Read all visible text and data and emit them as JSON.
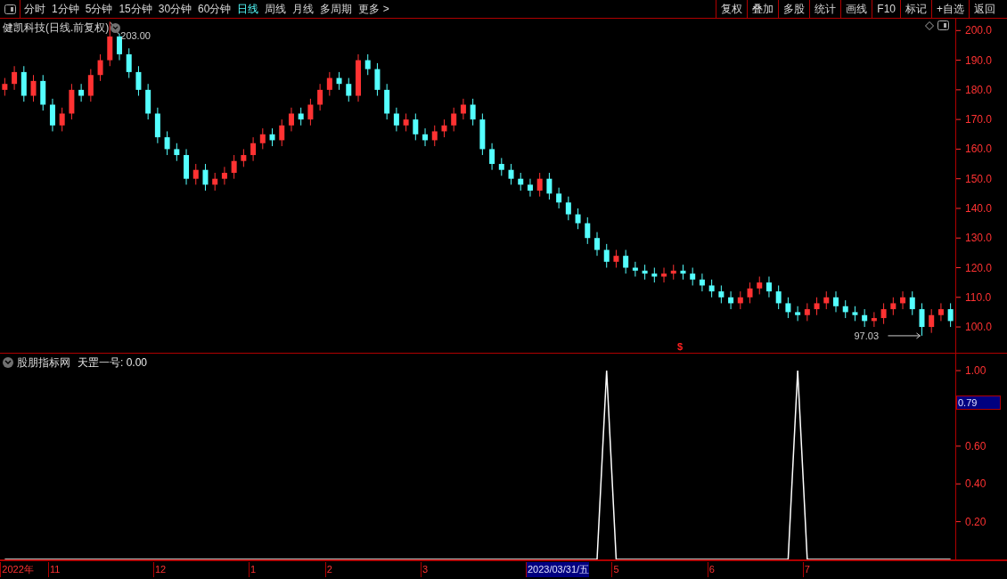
{
  "toolbar": {
    "periods": [
      {
        "label": "分时",
        "selected": false
      },
      {
        "label": "1分钟",
        "selected": false
      },
      {
        "label": "5分钟",
        "selected": false
      },
      {
        "label": "15分钟",
        "selected": false
      },
      {
        "label": "30分钟",
        "selected": false
      },
      {
        "label": "60分钟",
        "selected": false
      },
      {
        "label": "日线",
        "selected": true
      },
      {
        "label": "周线",
        "selected": false
      },
      {
        "label": "月线",
        "selected": false
      },
      {
        "label": "多周期",
        "selected": false
      }
    ],
    "more": "更多 >",
    "buttons": [
      "复权",
      "叠加",
      "多股",
      "统计",
      "画线",
      "F10",
      "标记",
      "+自选",
      "返回"
    ]
  },
  "price_panel": {
    "title": "健凯科技(日线.前复权)",
    "marker": "$",
    "chart_data": {
      "type": "candlestick",
      "ylim": [
        91,
        204
      ],
      "yticks": [
        {
          "value": 100,
          "label": "100.0"
        },
        {
          "value": 110,
          "label": "110.0"
        },
        {
          "value": 120,
          "label": "120.0"
        },
        {
          "value": 130,
          "label": "130.0"
        },
        {
          "value": 140,
          "label": "140.0"
        },
        {
          "value": 150,
          "label": "150.0"
        },
        {
          "value": 160,
          "label": "160.0"
        },
        {
          "value": 170,
          "label": "170.0"
        },
        {
          "value": 180,
          "label": "180.0"
        },
        {
          "value": 190,
          "label": "190.0"
        },
        {
          "value": 200,
          "label": "200.0"
        }
      ],
      "ohlc": [
        [
          180,
          184,
          178,
          182
        ],
        [
          182,
          188,
          180,
          186
        ],
        [
          186,
          188,
          176,
          178
        ],
        [
          178,
          185,
          176,
          183
        ],
        [
          183,
          185,
          173,
          175
        ],
        [
          175,
          177,
          166,
          168
        ],
        [
          168,
          174,
          166,
          172
        ],
        [
          172,
          182,
          170,
          180
        ],
        [
          180,
          182,
          176,
          178
        ],
        [
          178,
          187,
          176,
          185
        ],
        [
          185,
          192,
          183,
          190
        ],
        [
          190,
          203,
          188,
          198
        ],
        [
          198,
          199,
          190,
          192
        ],
        [
          192,
          194,
          184,
          186
        ],
        [
          186,
          188,
          178,
          180
        ],
        [
          180,
          182,
          170,
          172
        ],
        [
          172,
          174,
          162,
          164
        ],
        [
          164,
          166,
          158,
          160
        ],
        [
          160,
          162,
          156,
          158
        ],
        [
          158,
          160,
          148,
          150
        ],
        [
          150,
          155,
          148,
          153
        ],
        [
          153,
          155,
          146,
          148
        ],
        [
          148,
          152,
          146,
          150
        ],
        [
          150,
          154,
          148,
          152
        ],
        [
          152,
          158,
          150,
          156
        ],
        [
          156,
          160,
          154,
          158
        ],
        [
          158,
          164,
          156,
          162
        ],
        [
          162,
          167,
          160,
          165
        ],
        [
          165,
          167,
          161,
          163
        ],
        [
          163,
          170,
          161,
          168
        ],
        [
          168,
          174,
          166,
          172
        ],
        [
          172,
          174,
          168,
          170
        ],
        [
          170,
          177,
          168,
          175
        ],
        [
          175,
          182,
          173,
          180
        ],
        [
          180,
          186,
          178,
          184
        ],
        [
          184,
          186,
          180,
          182
        ],
        [
          182,
          184,
          176,
          178
        ],
        [
          178,
          192,
          176,
          190
        ],
        [
          190,
          192,
          185,
          187
        ],
        [
          187,
          189,
          178,
          180
        ],
        [
          180,
          182,
          170,
          172
        ],
        [
          172,
          174,
          166,
          168
        ],
        [
          168,
          172,
          166,
          170
        ],
        [
          170,
          172,
          163,
          165
        ],
        [
          165,
          167,
          161,
          163
        ],
        [
          163,
          168,
          161,
          166
        ],
        [
          166,
          170,
          164,
          168
        ],
        [
          168,
          174,
          166,
          172
        ],
        [
          172,
          177,
          170,
          175
        ],
        [
          175,
          177,
          168,
          170
        ],
        [
          170,
          172,
          158,
          160
        ],
        [
          160,
          162,
          153,
          155
        ],
        [
          155,
          157,
          151,
          153
        ],
        [
          153,
          155,
          148,
          150
        ],
        [
          150,
          152,
          146,
          148
        ],
        [
          148,
          150,
          144,
          146
        ],
        [
          146,
          152,
          144,
          150
        ],
        [
          150,
          152,
          143,
          145
        ],
        [
          145,
          147,
          140,
          142
        ],
        [
          142,
          144,
          136,
          138
        ],
        [
          138,
          140,
          133,
          135
        ],
        [
          135,
          137,
          128,
          130
        ],
        [
          130,
          132,
          124,
          126
        ],
        [
          126,
          128,
          120,
          122
        ],
        [
          122,
          126,
          120,
          124
        ],
        [
          124,
          126,
          118,
          120
        ],
        [
          120,
          122,
          117,
          119
        ],
        [
          119,
          121,
          116,
          118
        ],
        [
          118,
          120,
          115,
          117
        ],
        [
          117,
          120,
          115,
          118
        ],
        [
          118,
          121,
          116,
          119
        ],
        [
          119,
          121,
          116,
          118
        ],
        [
          118,
          120,
          114,
          116
        ],
        [
          116,
          118,
          112,
          114
        ],
        [
          114,
          116,
          110,
          112
        ],
        [
          112,
          114,
          108,
          110
        ],
        [
          110,
          112,
          106,
          108
        ],
        [
          108,
          112,
          106,
          110
        ],
        [
          110,
          115,
          108,
          113
        ],
        [
          113,
          117,
          111,
          115
        ],
        [
          115,
          117,
          110,
          112
        ],
        [
          112,
          114,
          106,
          108
        ],
        [
          108,
          110,
          103,
          105
        ],
        [
          105,
          107,
          102,
          104
        ],
        [
          104,
          108,
          102,
          106
        ],
        [
          106,
          110,
          104,
          108
        ],
        [
          108,
          112,
          106,
          110
        ],
        [
          110,
          112,
          105,
          107
        ],
        [
          107,
          109,
          103,
          105
        ],
        [
          105,
          107,
          102,
          104
        ],
        [
          104,
          106,
          100,
          102
        ],
        [
          102,
          105,
          100,
          103
        ],
        [
          103,
          108,
          101,
          106
        ],
        [
          106,
          110,
          104,
          108
        ],
        [
          108,
          112,
          106,
          110
        ],
        [
          110,
          112,
          104,
          106
        ],
        [
          106,
          108,
          97.03,
          100
        ],
        [
          100,
          106,
          98,
          104
        ],
        [
          104,
          108,
          102,
          106
        ],
        [
          106,
          108,
          100,
          102
        ]
      ],
      "annotations": [
        {
          "text": "203.00"
        },
        {
          "text": "97.03"
        }
      ]
    }
  },
  "indicator_panel": {
    "title": "股朋指标网",
    "reading": "天罡一号: 0.00",
    "current_value": "0.79",
    "chart_data": {
      "type": "line",
      "ylim": [
        0,
        1.09
      ],
      "yticks": [
        {
          "value": 0.2,
          "label": "0.20"
        },
        {
          "value": 0.4,
          "label": "0.40"
        },
        {
          "value": 0.6,
          "label": "0.60"
        },
        {
          "value": 1,
          "label": "1.00"
        }
      ],
      "series": [
        {
          "color": "#ffffff",
          "values": [
            0,
            0,
            0,
            0,
            0,
            0,
            0,
            0,
            0,
            0,
            0,
            0,
            0,
            0,
            0,
            0,
            0,
            0,
            0,
            0,
            0,
            0,
            0,
            0,
            0,
            0,
            0,
            0,
            0,
            0,
            0,
            0,
            0,
            0,
            0,
            0,
            0,
            0,
            0,
            0,
            0,
            0,
            0,
            0,
            0,
            0,
            0,
            0,
            0,
            0,
            0,
            0,
            0,
            0,
            0,
            0,
            0,
            0,
            0,
            0,
            0,
            0,
            0,
            1,
            0,
            0,
            0,
            0,
            0,
            0,
            0,
            0,
            0,
            0,
            0,
            0,
            0,
            0,
            0,
            0,
            0,
            0,
            0,
            1,
            0,
            0,
            0,
            0,
            0,
            0,
            0,
            0,
            0,
            0,
            0,
            0,
            0,
            0,
            0,
            0
          ]
        }
      ]
    }
  },
  "time_axis": [
    {
      "label": "2022年",
      "selected": false
    },
    {
      "label": "11",
      "selected": false
    },
    {
      "label": "12",
      "selected": false
    },
    {
      "label": "1",
      "selected": false
    },
    {
      "label": "2",
      "selected": false
    },
    {
      "label": "3",
      "selected": false
    },
    {
      "label": "2023/03/31/五",
      "selected": true
    },
    {
      "label": "5",
      "selected": false
    },
    {
      "label": "6",
      "selected": false
    },
    {
      "label": "7",
      "selected": false
    }
  ]
}
